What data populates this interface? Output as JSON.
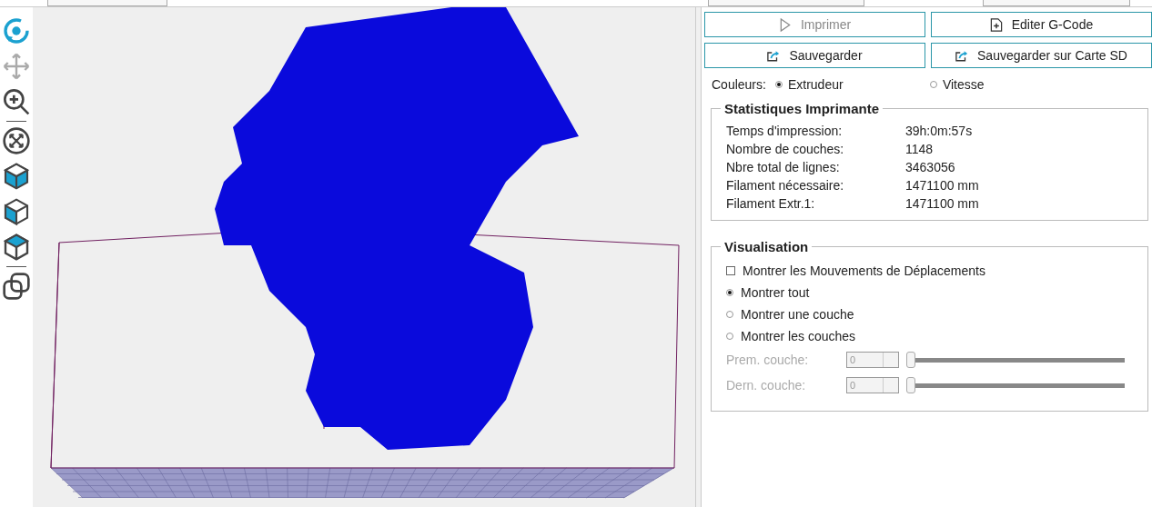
{
  "tools": [
    {
      "kind": "rotate",
      "disabled": false
    },
    {
      "kind": "move",
      "disabled": true
    },
    {
      "kind": "zoom",
      "disabled": false
    },
    {
      "kind": "separator"
    },
    {
      "kind": "fit",
      "disabled": false
    },
    {
      "kind": "cube-front",
      "disabled": false
    },
    {
      "kind": "cube-side",
      "disabled": false
    },
    {
      "kind": "cube-top",
      "disabled": false
    },
    {
      "kind": "separator"
    },
    {
      "kind": "overlap",
      "disabled": false
    }
  ],
  "buttons": [
    {
      "label": "Imprimer",
      "kind": "play",
      "disabled": true
    },
    {
      "label": "Editer G-Code",
      "kind": "edit",
      "disabled": false
    },
    {
      "label": "Sauvegarder",
      "kind": "export",
      "disabled": false
    },
    {
      "label": "Sauvegarder sur Carte SD",
      "kind": "export",
      "disabled": false
    }
  ],
  "colors": {
    "label": "Couleurs:",
    "options": [
      {
        "label": "Extrudeur",
        "selected": true
      },
      {
        "label": "Vitesse",
        "selected": false
      }
    ]
  },
  "stats": {
    "title": "Statistiques Imprimante",
    "rows": [
      {
        "label": "Temps d'impression:",
        "value": "39h:0m:57s"
      },
      {
        "label": "Nombre de couches:",
        "value": "1148"
      },
      {
        "label": "Nbre total de lignes:",
        "value": "3463056"
      },
      {
        "label": "Filament nécessaire:",
        "value": "1471100 mm"
      },
      {
        "label": "Filament Extr.1:",
        "value": "1471100 mm"
      }
    ]
  },
  "visualisation": {
    "title": "Visualisation",
    "options": [
      {
        "kind": "checkbox",
        "label": "Montrer les Mouvements de Déplacements",
        "checked": false
      },
      {
        "kind": "radio",
        "label": "Montrer tout",
        "checked": true
      },
      {
        "kind": "radio",
        "label": "Montrer une couche",
        "checked": false
      },
      {
        "kind": "radio",
        "label": "Montrer les couches",
        "checked": false
      }
    ],
    "layers": [
      {
        "label": "Prem. couche:",
        "value": "0",
        "level": 0,
        "disabled": true
      },
      {
        "label": "Dern. couche:",
        "value": "0",
        "level": 0,
        "disabled": true
      }
    ]
  }
}
